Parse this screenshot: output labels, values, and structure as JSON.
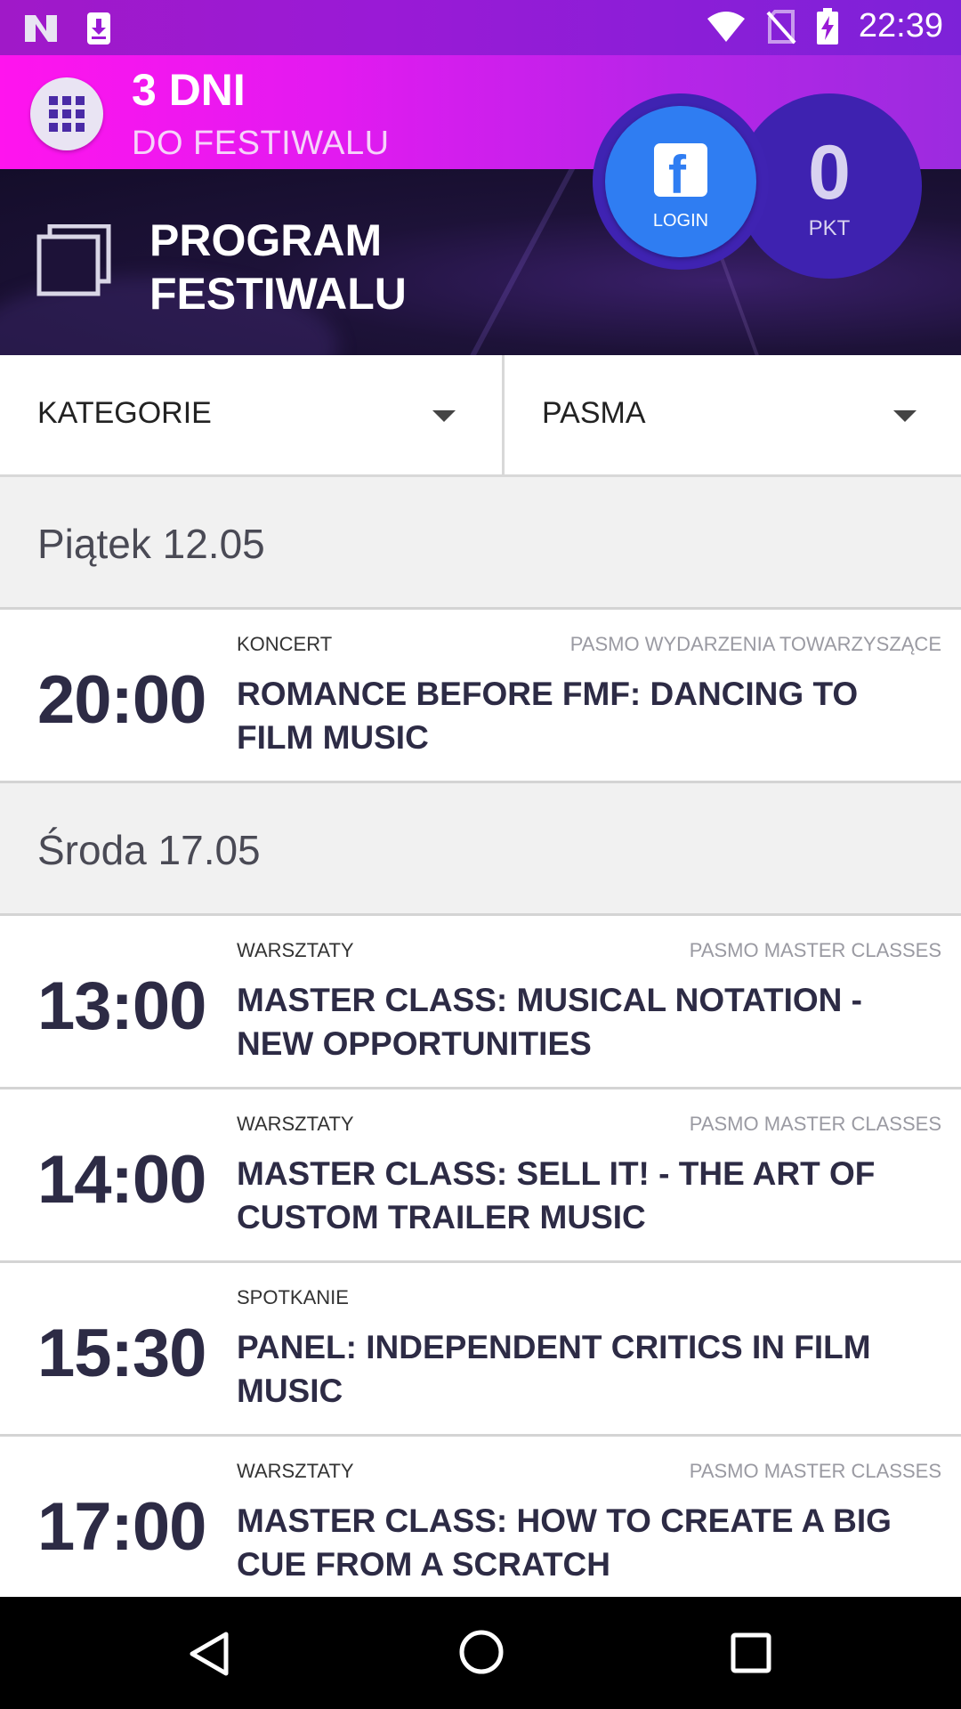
{
  "status_bar": {
    "time": "22:39",
    "icons": [
      "notification-n-icon",
      "download-icon",
      "wifi-icon",
      "no-sim-icon",
      "battery-charging-icon"
    ]
  },
  "countdown": {
    "number": "3 DNI",
    "subtitle": "DO FESTIWALU"
  },
  "header": {
    "title_line1": "PROGRAM",
    "title_line2": "FESTIWALU"
  },
  "facebook": {
    "label": "LOGIN"
  },
  "points": {
    "value": "0",
    "unit": "PKT"
  },
  "filters": {
    "categories_label": "KATEGORIE",
    "bands_label": "PASMA"
  },
  "days": [
    {
      "label": "Piątek 12.05",
      "events": [
        {
          "time": "20:00",
          "category": "KONCERT",
          "band": "PASMO WYDARZENIA TOWARZYSZĄCE",
          "title": "ROMANCE BEFORE FMF: DANCING TO FILM MUSIC"
        }
      ]
    },
    {
      "label": "Środa 17.05",
      "events": [
        {
          "time": "13:00",
          "category": "WARSZTATY",
          "band": "PASMO MASTER CLASSES",
          "title": "MASTER CLASS: MUSICAL NOTATION - NEW OPPORTUNITIES"
        },
        {
          "time": "14:00",
          "category": "WARSZTATY",
          "band": "PASMO MASTER CLASSES",
          "title": "MASTER CLASS: SELL IT! - THE ART OF CUSTOM TRAILER MUSIC"
        },
        {
          "time": "15:30",
          "category": "SPOTKANIE",
          "band": "",
          "title": "PANEL: INDEPENDENT CRITICS IN FILM MUSIC"
        },
        {
          "time": "17:00",
          "category": "WARSZTATY",
          "band": "PASMO MASTER CLASSES",
          "title": "MASTER CLASS: HOW TO CREATE A BIG CUE FROM A SCRATCH"
        }
      ]
    }
  ],
  "colors": {
    "countdown_pink": "#ff14ee",
    "header_dark": "#1d1238",
    "bubble_purple": "#3e22b0",
    "facebook_blue": "#2f7df2",
    "text_dark": "#2d2b45"
  }
}
